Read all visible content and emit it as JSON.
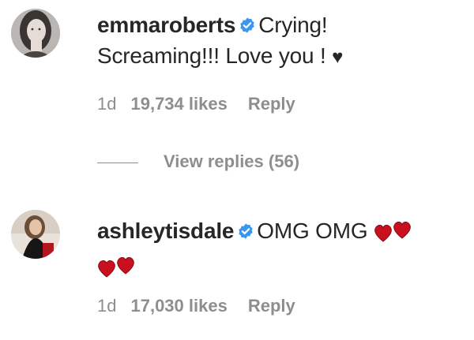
{
  "comments": [
    {
      "username": "emmaroberts",
      "text_line1": "Crying!",
      "text_line2": "Screaming!!! Love you !",
      "text_suffix_glyph": "♥",
      "age": "1d",
      "likes": "19,734 likes",
      "reply_label": "Reply",
      "avatar_icon": "user-avatar-photo"
    },
    {
      "username": "ashleytisdale",
      "text": "OMG OMG",
      "emoji": "red-hearts-emoji",
      "age": "1d",
      "likes": "17,030 likes",
      "reply_label": "Reply",
      "avatar_icon": "user-avatar-photo"
    }
  ],
  "view_replies": {
    "label": "View replies (56)"
  },
  "colors": {
    "text": "#262626",
    "meta": "#8e8e8e",
    "verified_badge": "#3897f0",
    "heart_emoji": "#d0021b"
  }
}
